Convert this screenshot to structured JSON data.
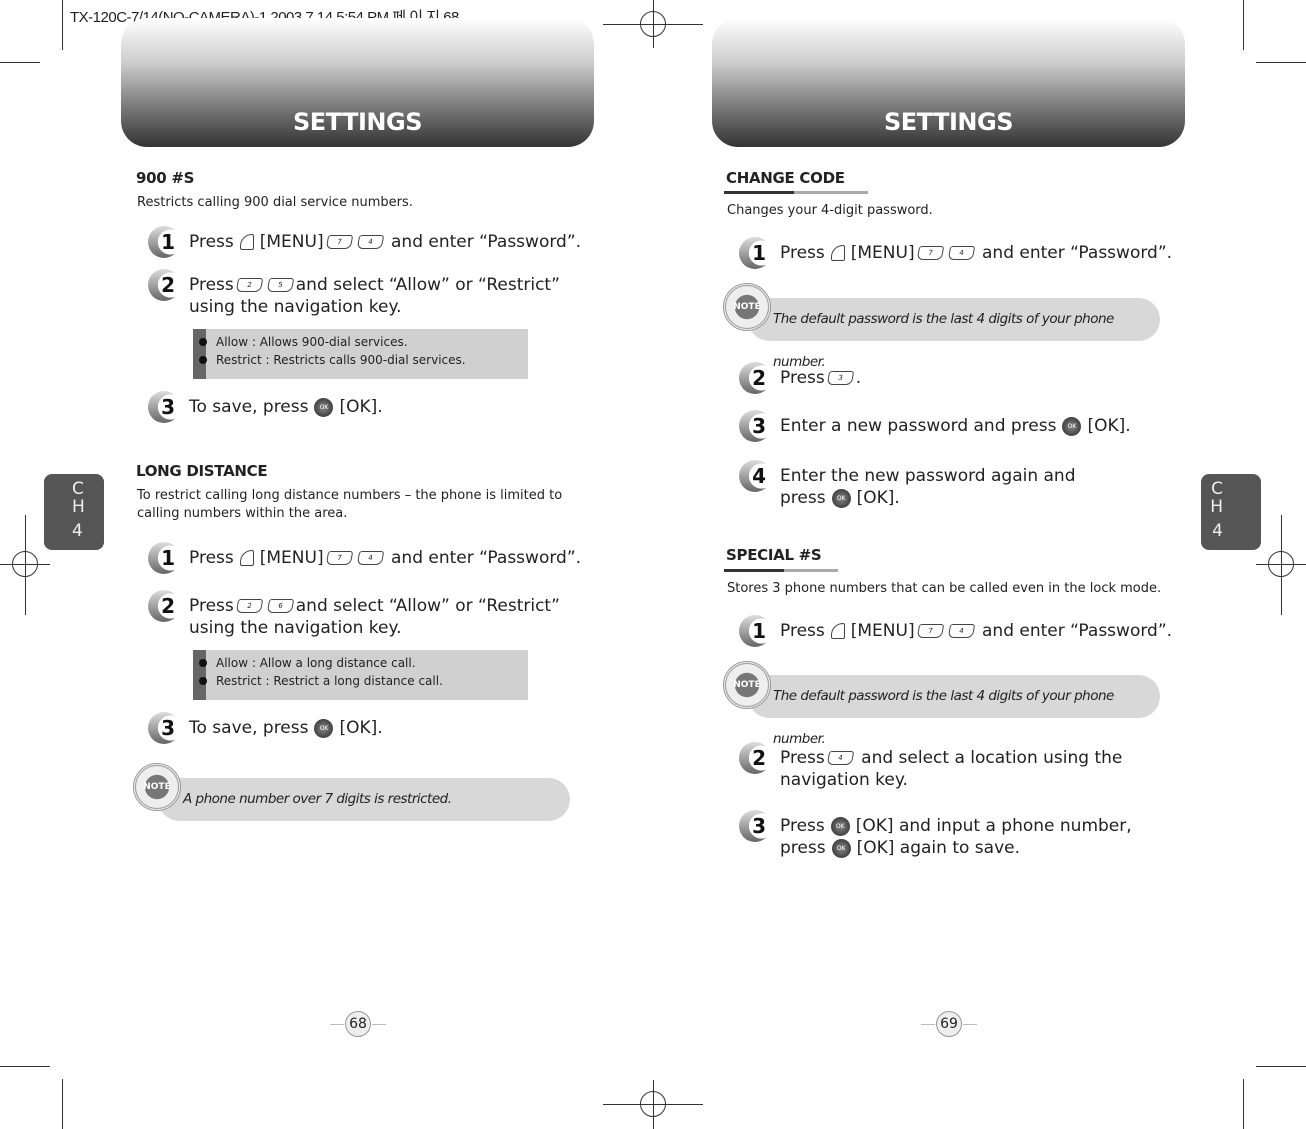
{
  "print_slug": "TX-120C-7/14(NO-CAMERA)-1  2003.7.14 5:54 PM 페 이 지 68",
  "colors": {
    "header_dark": "#333333",
    "box_gray": "#d0d0d0",
    "tab_gray": "#555555"
  },
  "chapter_tab": {
    "c": "C",
    "h": "H",
    "n": "4"
  },
  "left": {
    "header": "SETTINGS",
    "page_number": "68",
    "s900": {
      "title": "900 #S",
      "desc": "Restricts calling 900 dial service numbers.",
      "step1": {
        "n": "1",
        "a": "Press",
        "b": "[MENU]",
        "c": "and enter “Password”.",
        "k1": "7",
        "k2": "4"
      },
      "step2": {
        "n": "2",
        "a": "Press",
        "c": "and select “Allow” or “Restrict”",
        "d": "using the navigation key.",
        "k1": "2",
        "k2": "5"
      },
      "info": [
        "Allow : Allows 900-dial services.",
        "Restrict : Restricts calls 900-dial services."
      ],
      "step3": {
        "n": "3",
        "a": "To save, press",
        "b": "[OK].",
        "ok": "OK"
      }
    },
    "long": {
      "title": "LONG DISTANCE",
      "desc1": "To restrict calling long distance numbers – the phone is limited to",
      "desc2": "calling numbers within the area.",
      "step1": {
        "n": "1",
        "a": "Press",
        "b": "[MENU]",
        "c": "and enter “Password”.",
        "k1": "7",
        "k2": "4"
      },
      "step2": {
        "n": "2",
        "a": "Press",
        "c": "and select “Allow” or “Restrict”",
        "d": "using the navigation key.",
        "k1": "2",
        "k2": "6"
      },
      "info": [
        "Allow : Allow a long distance call.",
        "Restrict : Restrict a long distance call."
      ],
      "step3": {
        "n": "3",
        "a": "To save, press",
        "b": "[OK].",
        "ok": "OK"
      },
      "note_label": "NOTE",
      "note": "A phone number over 7 digits is restricted."
    }
  },
  "right": {
    "header": "SETTINGS",
    "page_number": "69",
    "change": {
      "title": "CHANGE CODE",
      "desc": "Changes your 4-digit password.",
      "step1": {
        "n": "1",
        "a": "Press",
        "b": "[MENU]",
        "c": "and enter “Password”.",
        "k1": "7",
        "k2": "4"
      },
      "note_label": "NOTE",
      "note": "The default password is the last 4 digits of your phone number.",
      "step2": {
        "n": "2",
        "a": "Press",
        "c": ".",
        "k1": "3"
      },
      "step3": {
        "n": "3",
        "a": "Enter a new password and press",
        "b": "[OK].",
        "ok": "OK"
      },
      "step4": {
        "n": "4",
        "a": "Enter the new password again and",
        "d": "press",
        "b": "[OK].",
        "ok": "OK"
      }
    },
    "special": {
      "title": "SPECIAL #S",
      "desc": "Stores 3 phone numbers that can be called even in the lock mode.",
      "step1": {
        "n": "1",
        "a": "Press",
        "b": "[MENU]",
        "c": "and enter “Password”.",
        "k1": "7",
        "k2": "4"
      },
      "note_label": "NOTE",
      "note": "The default password is the last 4 digits of your phone number.",
      "step2": {
        "n": "2",
        "a": "Press",
        "c": "and select a location using the",
        "d": "navigation key.",
        "k1": "4"
      },
      "step3": {
        "n": "3",
        "a": "Press",
        "b": "[OK] and input a phone number,",
        "d": "press",
        "e": "[OK] again to save.",
        "ok": "OK"
      }
    }
  }
}
